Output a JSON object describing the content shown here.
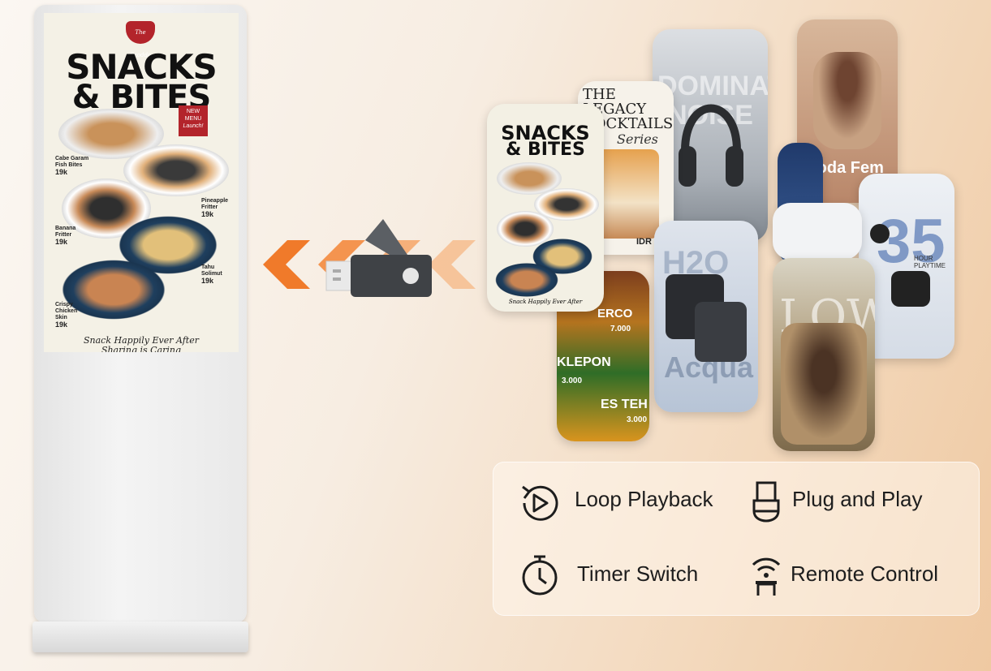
{
  "poster": {
    "brand": "The Scoddc",
    "title_line1": "SNACKS",
    "title_line2": "& BITES",
    "badge_line1": "NEW",
    "badge_line2": "MENU",
    "badge_line3": "Launch!",
    "items": [
      {
        "name": "Cabe Garam Fish Bites",
        "price": "19k"
      },
      {
        "name": "Pineapple Fritter",
        "price": "19k"
      },
      {
        "name": "Banana Fritter",
        "price": "19k"
      },
      {
        "name": "Tahu Solimut",
        "price": "19k"
      },
      {
        "name": "Crispy Chicken Skin",
        "price": "19k"
      }
    ],
    "tagline1": "Snack Happily Ever After",
    "tagline2": "Sharing is Caring"
  },
  "collage": {
    "legacy_title1": "THE",
    "legacy_title2": "LEGACY",
    "legacy_title3": "COCKTAILS",
    "legacy_series": "Series",
    "legacy_price": "IDR 26",
    "headphone_word": "DOMINATE NOISE",
    "fashion_label": "Moda Fem",
    "earbuds_number": "35",
    "earbuds_sub": "HOUR PLAYTIME",
    "camera_word1": "H2O",
    "camera_word2": "Acqua",
    "food_word1": "ERCO",
    "food_price1": "7.000",
    "food_word2": "KLEPON",
    "food_price2": "3.000",
    "food_word3": "ES TEH",
    "food_price3": "3.000",
    "low_word": "LOW",
    "mini_poster_title1": "SNACKS",
    "mini_poster_title2": "& BITES"
  },
  "features": [
    {
      "label": "Loop Playback",
      "icon": "loop-playback-icon"
    },
    {
      "label": "Plug and Play",
      "icon": "usb-plug-icon"
    },
    {
      "label": "Timer Switch",
      "icon": "stopwatch-icon"
    },
    {
      "label": "Remote Control",
      "icon": "remote-signal-icon"
    }
  ],
  "colors": {
    "accent_orange": "#f07a2a",
    "usb_gray": "#3f4246",
    "brand_red": "#b3242b"
  }
}
